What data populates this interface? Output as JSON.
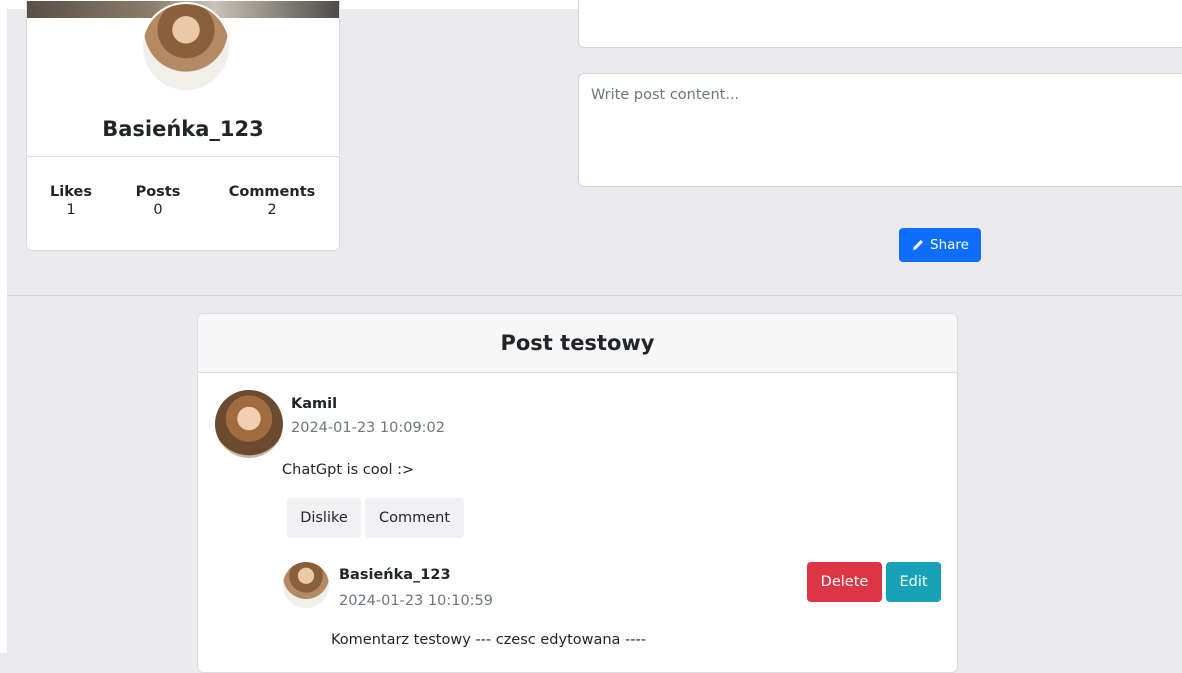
{
  "profile": {
    "username": "Basieńka_123",
    "stats": [
      {
        "label": "Likes",
        "value": "1"
      },
      {
        "label": "Posts",
        "value": "0"
      },
      {
        "label": "Comments",
        "value": "2"
      }
    ]
  },
  "post_form": {
    "content_placeholder": "Write post content...",
    "share_label": "Share",
    "share_icon": "pencil-icon"
  },
  "post": {
    "title": "Post testowy",
    "author": "Kamil",
    "date": "2024-01-23 10:09:02",
    "body": "ChatGpt is cool :>",
    "dislike_label": "Dislike",
    "comment_label": "Comment",
    "comment": {
      "author": "Basieńka_123",
      "date": "2024-01-23 10:10:59",
      "body": "Komentarz testowy --- czesc edytowana ----",
      "delete_label": "Delete",
      "edit_label": "Edit"
    }
  },
  "colors": {
    "primary": "#0d6efd",
    "danger": "#dc3545",
    "info": "#17a2b8",
    "page_bg": "#ebebef"
  }
}
